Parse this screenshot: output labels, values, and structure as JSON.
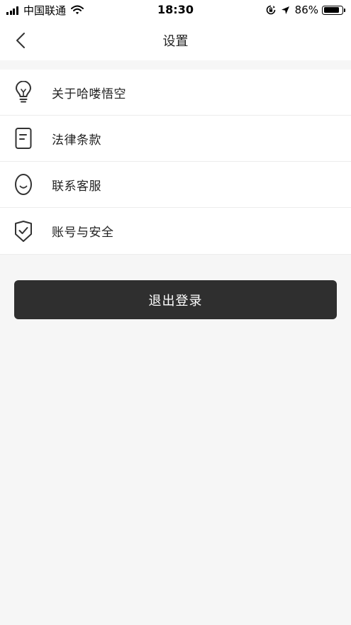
{
  "status_bar": {
    "carrier": "中国联通",
    "time": "18:30",
    "battery_percent": "86%",
    "battery_level": 0.86,
    "icons": [
      "signal-icon",
      "wifi-icon",
      "orientation-lock-icon",
      "location-icon",
      "battery-icon"
    ]
  },
  "nav": {
    "title": "设置",
    "back_icon": "chevron-left-icon"
  },
  "menu": [
    {
      "label": "关于哈喽悟空",
      "icon": "lightbulb-icon"
    },
    {
      "label": "法律条款",
      "icon": "document-icon"
    },
    {
      "label": "联系客服",
      "icon": "smile-face-icon"
    },
    {
      "label": "账号与安全",
      "icon": "shield-check-icon"
    }
  ],
  "logout": {
    "label": "退出登录"
  },
  "colors": {
    "background": "#f6f6f6",
    "surface": "#ffffff",
    "button": "#2f2f2f",
    "text": "#222222"
  }
}
